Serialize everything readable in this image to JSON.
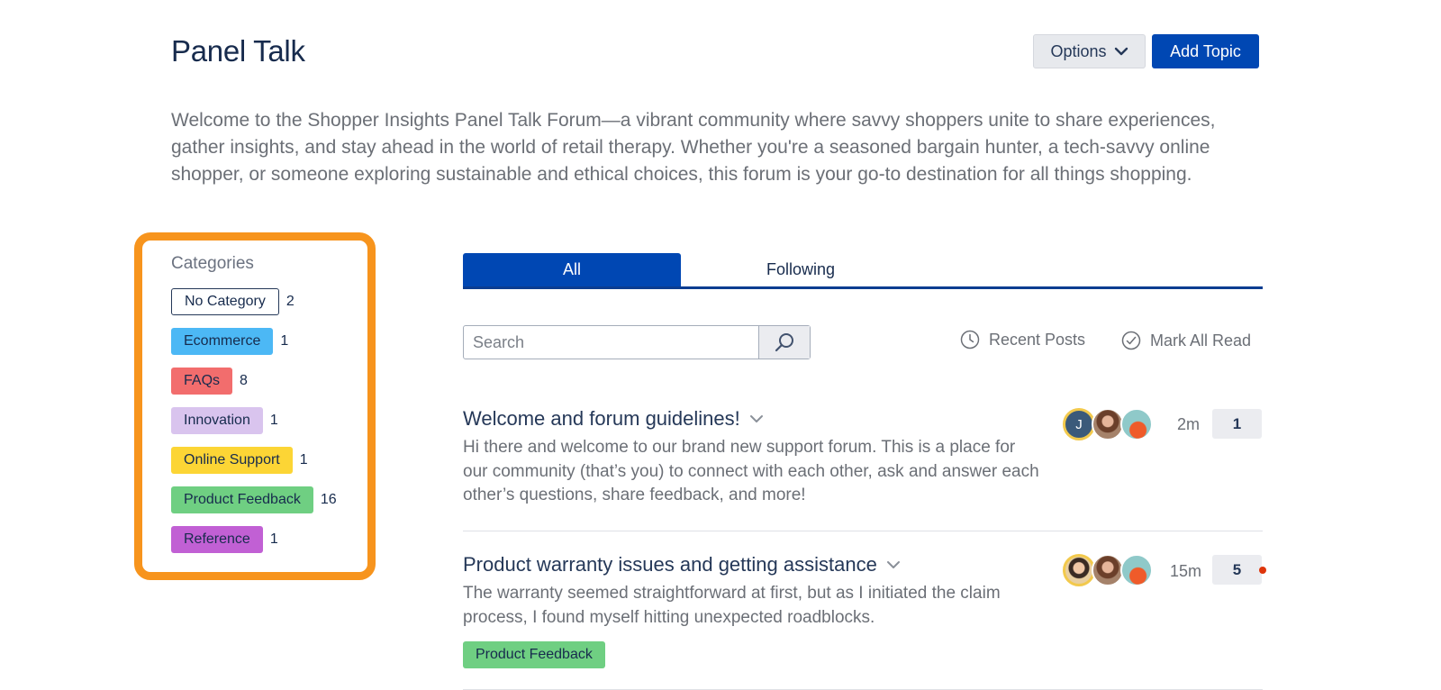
{
  "header": {
    "title": "Panel Talk",
    "options_label": "Options",
    "add_topic_label": "Add Topic"
  },
  "intro": "Welcome to the Shopper Insights Panel Talk Forum—a vibrant community where savvy shoppers unite to share experiences, gather insights, and stay ahead in the world of retail therapy. Whether you're a seasoned bargain hunter, a tech-savvy online shopper, or someone exploring sustainable and ethical choices, this forum is your go-to destination for all things shopping.",
  "categories": {
    "heading": "Categories",
    "items": [
      {
        "label": "No Category",
        "count": "2",
        "color": "#ffffff"
      },
      {
        "label": "Ecommerce",
        "count": "1",
        "color": "#4cb8f5"
      },
      {
        "label": "FAQs",
        "count": "8",
        "color": "#f26d6d"
      },
      {
        "label": "Innovation",
        "count": "1",
        "color": "#d9c4ee"
      },
      {
        "label": "Online Support",
        "count": "1",
        "color": "#fcd535"
      },
      {
        "label": "Product Feedback",
        "count": "16",
        "color": "#6fcf82"
      },
      {
        "label": "Reference",
        "count": "1",
        "color": "#c160d4"
      }
    ]
  },
  "tabs": {
    "all": "All",
    "following": "Following"
  },
  "search": {
    "placeholder": "Search"
  },
  "actions": {
    "recent_posts": "Recent Posts",
    "mark_all_read": "Mark All Read"
  },
  "topics": [
    {
      "title": "Welcome and forum guidelines!",
      "excerpt": "Hi there and welcome to our brand new support forum. This is a place for our community (that’s you) to connect with each other, ask and answer each other’s questions, share feedback, and more!",
      "avatar_letter": "J",
      "time": "2m",
      "count": "1"
    },
    {
      "title": "Product warranty issues and getting assistance",
      "excerpt": "The warranty seemed straightforward at first, but as I initiated the claim process, I found myself hitting unexpected roadblocks.",
      "tag": "Product Feedback",
      "time": "15m",
      "count": "5"
    }
  ],
  "colors": {
    "accent": "#0047b3",
    "highlight_border": "#f7941d",
    "unread": "#de350b"
  }
}
